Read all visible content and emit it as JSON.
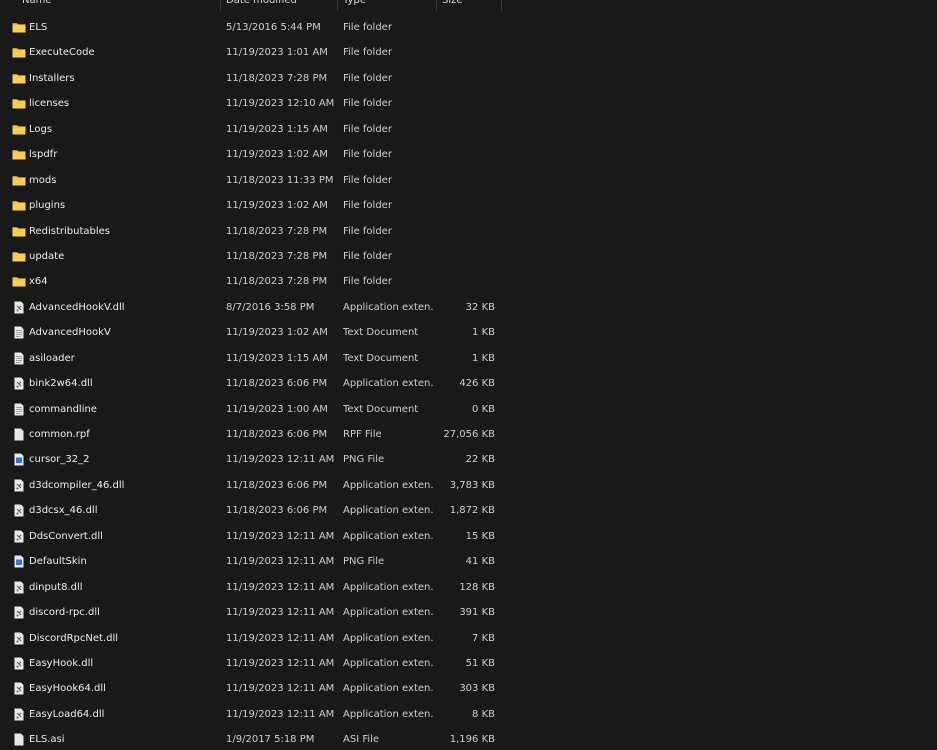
{
  "header": {
    "name": "Name",
    "date": "Date modified",
    "type": "Type",
    "size": "Size"
  },
  "colors": {
    "background": "#191919",
    "folder": "#f3c13a",
    "file": "#e8e8e8",
    "image_accent": "#2f77c9"
  },
  "rows": [
    {
      "name": "ELS",
      "date": "5/13/2016 5:44 PM",
      "type": "File folder",
      "size": "",
      "icon": "folder-icon"
    },
    {
      "name": "ExecuteCode",
      "date": "11/19/2023 1:01 AM",
      "type": "File folder",
      "size": "",
      "icon": "folder-icon"
    },
    {
      "name": "Installers",
      "date": "11/18/2023 7:28 PM",
      "type": "File folder",
      "size": "",
      "icon": "folder-icon"
    },
    {
      "name": "licenses",
      "date": "11/19/2023 12:10 AM",
      "type": "File folder",
      "size": "",
      "icon": "folder-icon"
    },
    {
      "name": "Logs",
      "date": "11/19/2023 1:15 AM",
      "type": "File folder",
      "size": "",
      "icon": "folder-icon"
    },
    {
      "name": "lspdfr",
      "date": "11/19/2023 1:02 AM",
      "type": "File folder",
      "size": "",
      "icon": "folder-icon"
    },
    {
      "name": "mods",
      "date": "11/18/2023 11:33 PM",
      "type": "File folder",
      "size": "",
      "icon": "folder-icon"
    },
    {
      "name": "plugins",
      "date": "11/19/2023 1:02 AM",
      "type": "File folder",
      "size": "",
      "icon": "folder-icon"
    },
    {
      "name": "Redistributables",
      "date": "11/18/2023 7:28 PM",
      "type": "File folder",
      "size": "",
      "icon": "folder-icon"
    },
    {
      "name": "update",
      "date": "11/18/2023 7:28 PM",
      "type": "File folder",
      "size": "",
      "icon": "folder-icon"
    },
    {
      "name": "x64",
      "date": "11/18/2023 7:28 PM",
      "type": "File folder",
      "size": "",
      "icon": "folder-icon"
    },
    {
      "name": "AdvancedHookV.dll",
      "date": "8/7/2016 3:58 PM",
      "type": "Application exten...",
      "size": "32 KB",
      "icon": "dll-file-icon"
    },
    {
      "name": "AdvancedHookV",
      "date": "11/19/2023 1:02 AM",
      "type": "Text Document",
      "size": "1 KB",
      "icon": "text-file-icon"
    },
    {
      "name": "asiloader",
      "date": "11/19/2023 1:15 AM",
      "type": "Text Document",
      "size": "1 KB",
      "icon": "text-file-icon"
    },
    {
      "name": "bink2w64.dll",
      "date": "11/18/2023 6:06 PM",
      "type": "Application exten...",
      "size": "426 KB",
      "icon": "dll-file-icon"
    },
    {
      "name": "commandline",
      "date": "11/19/2023 1:00 AM",
      "type": "Text Document",
      "size": "0 KB",
      "icon": "text-file-icon"
    },
    {
      "name": "common.rpf",
      "date": "11/18/2023 6:06 PM",
      "type": "RPF File",
      "size": "27,056 KB",
      "icon": "blank-file-icon"
    },
    {
      "name": "cursor_32_2",
      "date": "11/19/2023 12:11 AM",
      "type": "PNG File",
      "size": "22 KB",
      "icon": "image-file-icon"
    },
    {
      "name": "d3dcompiler_46.dll",
      "date": "11/18/2023 6:06 PM",
      "type": "Application exten...",
      "size": "3,783 KB",
      "icon": "dll-file-icon"
    },
    {
      "name": "d3dcsx_46.dll",
      "date": "11/18/2023 6:06 PM",
      "type": "Application exten...",
      "size": "1,872 KB",
      "icon": "dll-file-icon"
    },
    {
      "name": "DdsConvert.dll",
      "date": "11/19/2023 12:11 AM",
      "type": "Application exten...",
      "size": "15 KB",
      "icon": "dll-file-icon"
    },
    {
      "name": "DefaultSkin",
      "date": "11/19/2023 12:11 AM",
      "type": "PNG File",
      "size": "41 KB",
      "icon": "image-file-icon"
    },
    {
      "name": "dinput8.dll",
      "date": "11/19/2023 12:11 AM",
      "type": "Application exten...",
      "size": "128 KB",
      "icon": "dll-file-icon"
    },
    {
      "name": "discord-rpc.dll",
      "date": "11/19/2023 12:11 AM",
      "type": "Application exten...",
      "size": "391 KB",
      "icon": "dll-file-icon"
    },
    {
      "name": "DiscordRpcNet.dll",
      "date": "11/19/2023 12:11 AM",
      "type": "Application exten...",
      "size": "7 KB",
      "icon": "dll-file-icon"
    },
    {
      "name": "EasyHook.dll",
      "date": "11/19/2023 12:11 AM",
      "type": "Application exten...",
      "size": "51 KB",
      "icon": "dll-file-icon"
    },
    {
      "name": "EasyHook64.dll",
      "date": "11/19/2023 12:11 AM",
      "type": "Application exten...",
      "size": "303 KB",
      "icon": "dll-file-icon"
    },
    {
      "name": "EasyLoad64.dll",
      "date": "11/19/2023 12:11 AM",
      "type": "Application exten...",
      "size": "8 KB",
      "icon": "dll-file-icon"
    },
    {
      "name": "ELS.asi",
      "date": "1/9/2017 5:18 PM",
      "type": "ASI File",
      "size": "1,196 KB",
      "icon": "blank-file-icon"
    }
  ]
}
